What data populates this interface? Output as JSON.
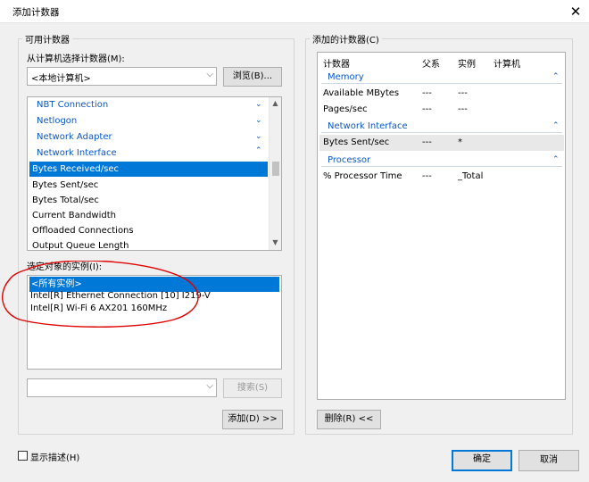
{
  "window": {
    "title": "添加计数器",
    "close_glyph": "✕"
  },
  "available": {
    "group_label": "可用计数器",
    "select_from_label": "从计算机选择计数器(M):",
    "computer_value": "<本地计算机>",
    "browse_label": "浏览(B)...",
    "items": [
      {
        "label": "NBT Connection",
        "type": "category"
      },
      {
        "label": "Netlogon",
        "type": "category"
      },
      {
        "label": "Network Adapter",
        "type": "category"
      },
      {
        "label": "Network Interface",
        "type": "category-expanded"
      },
      {
        "label": "Bytes Received/sec",
        "type": "counter",
        "selected": true
      },
      {
        "label": "Bytes Sent/sec",
        "type": "counter"
      },
      {
        "label": "Bytes Total/sec",
        "type": "counter"
      },
      {
        "label": "Current Bandwidth",
        "type": "counter"
      },
      {
        "label": "Offloaded Connections",
        "type": "counter"
      },
      {
        "label": "Output Queue Length",
        "type": "counter"
      }
    ],
    "instances_label": "选定对象的实例(I):",
    "instances": [
      {
        "label": "<所有实例>",
        "selected": true
      },
      {
        "label": "Intel[R] Ethernet Connection [10] I219-V"
      },
      {
        "label": "Intel[R] Wi-Fi 6 AX201 160MHz"
      }
    ],
    "search_value": "",
    "search_label": "搜索(S)",
    "add_label": "添加(D) >>"
  },
  "added": {
    "group_label": "添加的计数器(C)",
    "columns": [
      "计数器",
      "父系",
      "实例",
      "计算机"
    ],
    "sections": [
      {
        "name": "Memory",
        "rows": [
          {
            "counter": "Available MBytes",
            "parent": "---",
            "instance": "---",
            "computer": ""
          },
          {
            "counter": "Pages/sec",
            "parent": "---",
            "instance": "---",
            "computer": ""
          }
        ]
      },
      {
        "name": "Network Interface",
        "rows": [
          {
            "counter": "Bytes Sent/sec",
            "parent": "---",
            "instance": "*",
            "computer": ""
          }
        ]
      },
      {
        "name": "Processor",
        "rows": [
          {
            "counter": "% Processor Time",
            "parent": "---",
            "instance": "_Total",
            "computer": ""
          }
        ]
      }
    ],
    "remove_label": "删除(R) <<"
  },
  "footer": {
    "show_description_label": "显示描述(H)",
    "show_description_checked": false,
    "ok_label": "确定",
    "cancel_label": "取消"
  },
  "icons": {
    "dropdown": "chevron-down-icon",
    "expand": "chevron-down-icon",
    "collapse": "chevron-up-icon",
    "close": "close-icon"
  },
  "colors": {
    "selection": "#0078d7",
    "category_text": "#0a57c5",
    "annotation_circle": "#e00000"
  }
}
